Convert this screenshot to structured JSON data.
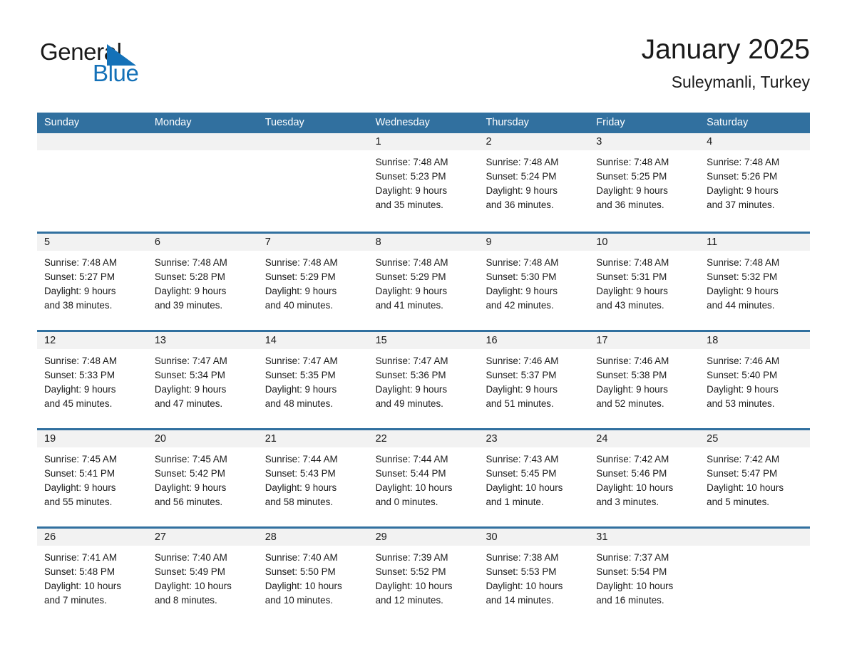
{
  "brand": {
    "name_part1": "General",
    "name_part2": "Blue",
    "accent_color": "#1471b8"
  },
  "header": {
    "title": "January 2025",
    "subtitle": "Suleymanli, Turkey"
  },
  "theme": {
    "header_row_color": "#31709f",
    "daynum_band_color": "#f2f2f2",
    "week_divider_color": "#31709f"
  },
  "weekday_headers": [
    "Sunday",
    "Monday",
    "Tuesday",
    "Wednesday",
    "Thursday",
    "Friday",
    "Saturday"
  ],
  "weeks": [
    [
      {
        "day": "",
        "sunrise": "",
        "sunset": "",
        "daylight1": "",
        "daylight2": ""
      },
      {
        "day": "",
        "sunrise": "",
        "sunset": "",
        "daylight1": "",
        "daylight2": ""
      },
      {
        "day": "",
        "sunrise": "",
        "sunset": "",
        "daylight1": "",
        "daylight2": ""
      },
      {
        "day": "1",
        "sunrise": "Sunrise: 7:48 AM",
        "sunset": "Sunset: 5:23 PM",
        "daylight1": "Daylight: 9 hours",
        "daylight2": "and 35 minutes."
      },
      {
        "day": "2",
        "sunrise": "Sunrise: 7:48 AM",
        "sunset": "Sunset: 5:24 PM",
        "daylight1": "Daylight: 9 hours",
        "daylight2": "and 36 minutes."
      },
      {
        "day": "3",
        "sunrise": "Sunrise: 7:48 AM",
        "sunset": "Sunset: 5:25 PM",
        "daylight1": "Daylight: 9 hours",
        "daylight2": "and 36 minutes."
      },
      {
        "day": "4",
        "sunrise": "Sunrise: 7:48 AM",
        "sunset": "Sunset: 5:26 PM",
        "daylight1": "Daylight: 9 hours",
        "daylight2": "and 37 minutes."
      }
    ],
    [
      {
        "day": "5",
        "sunrise": "Sunrise: 7:48 AM",
        "sunset": "Sunset: 5:27 PM",
        "daylight1": "Daylight: 9 hours",
        "daylight2": "and 38 minutes."
      },
      {
        "day": "6",
        "sunrise": "Sunrise: 7:48 AM",
        "sunset": "Sunset: 5:28 PM",
        "daylight1": "Daylight: 9 hours",
        "daylight2": "and 39 minutes."
      },
      {
        "day": "7",
        "sunrise": "Sunrise: 7:48 AM",
        "sunset": "Sunset: 5:29 PM",
        "daylight1": "Daylight: 9 hours",
        "daylight2": "and 40 minutes."
      },
      {
        "day": "8",
        "sunrise": "Sunrise: 7:48 AM",
        "sunset": "Sunset: 5:29 PM",
        "daylight1": "Daylight: 9 hours",
        "daylight2": "and 41 minutes."
      },
      {
        "day": "9",
        "sunrise": "Sunrise: 7:48 AM",
        "sunset": "Sunset: 5:30 PM",
        "daylight1": "Daylight: 9 hours",
        "daylight2": "and 42 minutes."
      },
      {
        "day": "10",
        "sunrise": "Sunrise: 7:48 AM",
        "sunset": "Sunset: 5:31 PM",
        "daylight1": "Daylight: 9 hours",
        "daylight2": "and 43 minutes."
      },
      {
        "day": "11",
        "sunrise": "Sunrise: 7:48 AM",
        "sunset": "Sunset: 5:32 PM",
        "daylight1": "Daylight: 9 hours",
        "daylight2": "and 44 minutes."
      }
    ],
    [
      {
        "day": "12",
        "sunrise": "Sunrise: 7:48 AM",
        "sunset": "Sunset: 5:33 PM",
        "daylight1": "Daylight: 9 hours",
        "daylight2": "and 45 minutes."
      },
      {
        "day": "13",
        "sunrise": "Sunrise: 7:47 AM",
        "sunset": "Sunset: 5:34 PM",
        "daylight1": "Daylight: 9 hours",
        "daylight2": "and 47 minutes."
      },
      {
        "day": "14",
        "sunrise": "Sunrise: 7:47 AM",
        "sunset": "Sunset: 5:35 PM",
        "daylight1": "Daylight: 9 hours",
        "daylight2": "and 48 minutes."
      },
      {
        "day": "15",
        "sunrise": "Sunrise: 7:47 AM",
        "sunset": "Sunset: 5:36 PM",
        "daylight1": "Daylight: 9 hours",
        "daylight2": "and 49 minutes."
      },
      {
        "day": "16",
        "sunrise": "Sunrise: 7:46 AM",
        "sunset": "Sunset: 5:37 PM",
        "daylight1": "Daylight: 9 hours",
        "daylight2": "and 51 minutes."
      },
      {
        "day": "17",
        "sunrise": "Sunrise: 7:46 AM",
        "sunset": "Sunset: 5:38 PM",
        "daylight1": "Daylight: 9 hours",
        "daylight2": "and 52 minutes."
      },
      {
        "day": "18",
        "sunrise": "Sunrise: 7:46 AM",
        "sunset": "Sunset: 5:40 PM",
        "daylight1": "Daylight: 9 hours",
        "daylight2": "and 53 minutes."
      }
    ],
    [
      {
        "day": "19",
        "sunrise": "Sunrise: 7:45 AM",
        "sunset": "Sunset: 5:41 PM",
        "daylight1": "Daylight: 9 hours",
        "daylight2": "and 55 minutes."
      },
      {
        "day": "20",
        "sunrise": "Sunrise: 7:45 AM",
        "sunset": "Sunset: 5:42 PM",
        "daylight1": "Daylight: 9 hours",
        "daylight2": "and 56 minutes."
      },
      {
        "day": "21",
        "sunrise": "Sunrise: 7:44 AM",
        "sunset": "Sunset: 5:43 PM",
        "daylight1": "Daylight: 9 hours",
        "daylight2": "and 58 minutes."
      },
      {
        "day": "22",
        "sunrise": "Sunrise: 7:44 AM",
        "sunset": "Sunset: 5:44 PM",
        "daylight1": "Daylight: 10 hours",
        "daylight2": "and 0 minutes."
      },
      {
        "day": "23",
        "sunrise": "Sunrise: 7:43 AM",
        "sunset": "Sunset: 5:45 PM",
        "daylight1": "Daylight: 10 hours",
        "daylight2": "and 1 minute."
      },
      {
        "day": "24",
        "sunrise": "Sunrise: 7:42 AM",
        "sunset": "Sunset: 5:46 PM",
        "daylight1": "Daylight: 10 hours",
        "daylight2": "and 3 minutes."
      },
      {
        "day": "25",
        "sunrise": "Sunrise: 7:42 AM",
        "sunset": "Sunset: 5:47 PM",
        "daylight1": "Daylight: 10 hours",
        "daylight2": "and 5 minutes."
      }
    ],
    [
      {
        "day": "26",
        "sunrise": "Sunrise: 7:41 AM",
        "sunset": "Sunset: 5:48 PM",
        "daylight1": "Daylight: 10 hours",
        "daylight2": "and 7 minutes."
      },
      {
        "day": "27",
        "sunrise": "Sunrise: 7:40 AM",
        "sunset": "Sunset: 5:49 PM",
        "daylight1": "Daylight: 10 hours",
        "daylight2": "and 8 minutes."
      },
      {
        "day": "28",
        "sunrise": "Sunrise: 7:40 AM",
        "sunset": "Sunset: 5:50 PM",
        "daylight1": "Daylight: 10 hours",
        "daylight2": "and 10 minutes."
      },
      {
        "day": "29",
        "sunrise": "Sunrise: 7:39 AM",
        "sunset": "Sunset: 5:52 PM",
        "daylight1": "Daylight: 10 hours",
        "daylight2": "and 12 minutes."
      },
      {
        "day": "30",
        "sunrise": "Sunrise: 7:38 AM",
        "sunset": "Sunset: 5:53 PM",
        "daylight1": "Daylight: 10 hours",
        "daylight2": "and 14 minutes."
      },
      {
        "day": "31",
        "sunrise": "Sunrise: 7:37 AM",
        "sunset": "Sunset: 5:54 PM",
        "daylight1": "Daylight: 10 hours",
        "daylight2": "and 16 minutes."
      },
      {
        "day": "",
        "sunrise": "",
        "sunset": "",
        "daylight1": "",
        "daylight2": ""
      }
    ]
  ]
}
